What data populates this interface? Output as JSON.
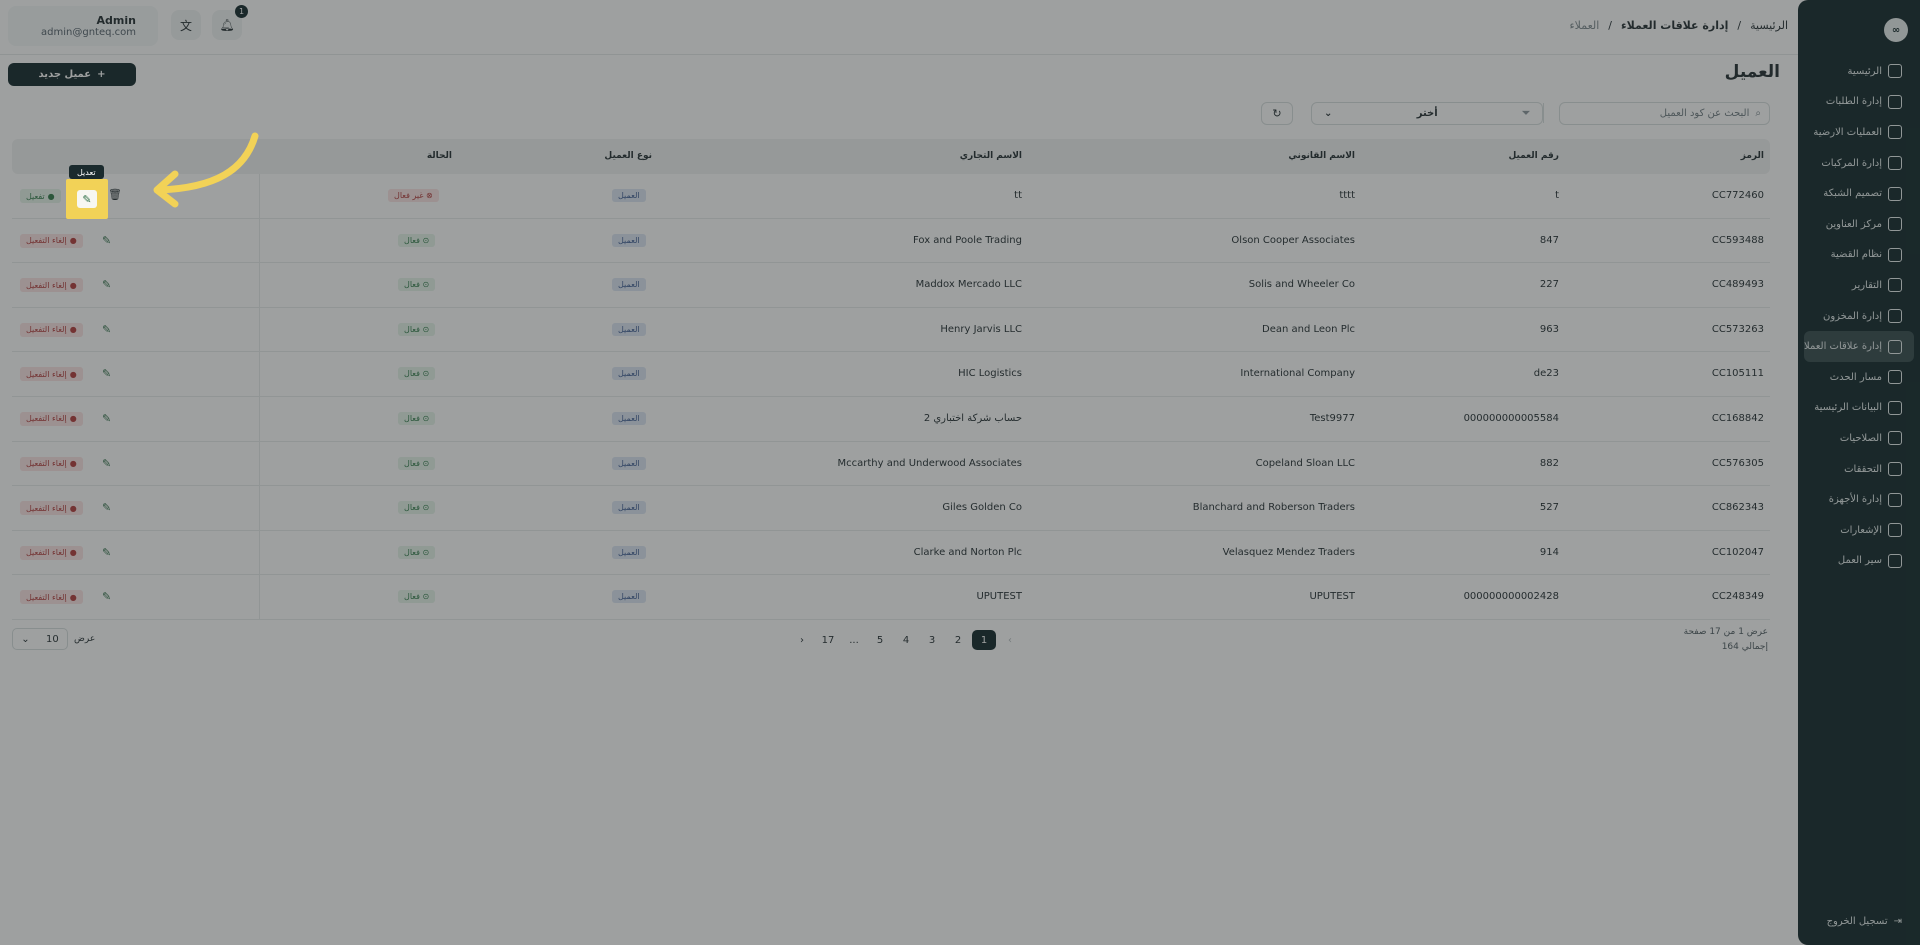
{
  "sidebar": {
    "logo": "∞",
    "items": [
      {
        "label": "الرئيسية",
        "icon": "dashboard-icon"
      },
      {
        "label": "إدارة الطلبات",
        "icon": "orders-icon"
      },
      {
        "label": "العمليات الارضية",
        "icon": "operations-icon"
      },
      {
        "label": "إدارة المركبات",
        "icon": "truck-icon"
      },
      {
        "label": "تصميم الشبكة",
        "icon": "network-icon"
      },
      {
        "label": "مركز العناوين",
        "icon": "location-icon"
      },
      {
        "label": "نظام القضية",
        "icon": "case-icon"
      },
      {
        "label": "التقارير",
        "icon": "reports-icon"
      },
      {
        "label": "إدارة المخزون",
        "icon": "inventory-icon"
      },
      {
        "label": "إدارة علاقات العملاء",
        "icon": "crm-icon",
        "active": true
      },
      {
        "label": "مسار الحدث",
        "icon": "route-icon"
      },
      {
        "label": "البيانات الرئيسية",
        "icon": "database-icon"
      },
      {
        "label": "الصلاحيات",
        "icon": "users-icon"
      },
      {
        "label": "التحققات",
        "icon": "tools-icon"
      },
      {
        "label": "إدارة الأجهزة",
        "icon": "device-icon"
      },
      {
        "label": "الإشعارات",
        "icon": "bell-icon"
      },
      {
        "label": "سير العمل",
        "icon": "workflow-icon"
      }
    ],
    "logout": "تسجيل الخروج"
  },
  "topbar": {
    "user_name": "Admin",
    "user_email": "admin@gnteq.com",
    "notif_count": "1",
    "breadcrumb": [
      "الرئيسية",
      "/",
      "إدارة علاقات العملاء",
      "/",
      "العملاء"
    ]
  },
  "header": {
    "title": "العميل",
    "new_button": "عميل جديد",
    "search_placeholder": "البحث عن كود العميل",
    "filter_label": "أختر"
  },
  "table": {
    "columns": [
      "الرمز",
      "رقم العميل",
      "الاسم القانوني",
      "الاسم التجاري",
      "نوع العميل",
      "الحالة"
    ],
    "rows": [
      {
        "code": "CC772460",
        "number": "t",
        "legal": "tttt",
        "trade": "tt",
        "type": "العميل",
        "status": "غير فعال",
        "action": "تفعيل",
        "active": false
      },
      {
        "code": "CC593488",
        "number": "847",
        "legal": "Olson Cooper Associates",
        "trade": "Fox and Poole Trading",
        "type": "العميل",
        "status": "فعال",
        "action": "إلغاء التفعيل",
        "active": true
      },
      {
        "code": "CC489493",
        "number": "227",
        "legal": "Solis and Wheeler Co",
        "trade": "Maddox Mercado LLC",
        "type": "العميل",
        "status": "فعال",
        "action": "إلغاء التفعيل",
        "active": true
      },
      {
        "code": "CC573263",
        "number": "963",
        "legal": "Dean and Leon Plc",
        "trade": "Henry Jarvis LLC",
        "type": "العميل",
        "status": "فعال",
        "action": "إلغاء التفعيل",
        "active": true
      },
      {
        "code": "CC105111",
        "number": "de23",
        "legal": "International Company",
        "trade": "HIC Logistics",
        "type": "العميل",
        "status": "فعال",
        "action": "إلغاء التفعيل",
        "active": true
      },
      {
        "code": "CC168842",
        "number": "000000000005584",
        "legal": "Test9977",
        "trade": "2 حساب شركة اختباري",
        "type": "العميل",
        "status": "فعال",
        "action": "إلغاء التفعيل",
        "active": true
      },
      {
        "code": "CC576305",
        "number": "882",
        "legal": "Copeland Sloan LLC",
        "trade": "Mccarthy and Underwood Associates",
        "type": "العميل",
        "status": "فعال",
        "action": "إلغاء التفعيل",
        "active": true
      },
      {
        "code": "CC862343",
        "number": "527",
        "legal": "Blanchard and Roberson Traders",
        "trade": "Giles Golden Co",
        "type": "العميل",
        "status": "فعال",
        "action": "إلغاء التفعيل",
        "active": true
      },
      {
        "code": "CC102047",
        "number": "914",
        "legal": "Velasquez Mendez Traders",
        "trade": "Clarke and Norton Plc",
        "type": "العميل",
        "status": "فعال",
        "action": "إلغاء التفعيل",
        "active": true
      },
      {
        "code": "CC248349",
        "number": "000000000002428",
        "legal": "UPUTEST",
        "trade": "UPUTEST",
        "type": "العميل",
        "status": "فعال",
        "action": "إلغاء التفعيل",
        "active": true
      }
    ]
  },
  "pagination": {
    "pages": [
      "‹",
      "1",
      "2",
      "3",
      "4",
      "5",
      "...",
      "17",
      "›"
    ],
    "current": "1",
    "info_line1": "عرض 1 من 17 صفحة",
    "info_line2": "إجمالي 164",
    "show_label": "عرض",
    "page_size": "10"
  },
  "overlay": {
    "tooltip": "تعديل",
    "highlight_color": "#f2d257"
  }
}
